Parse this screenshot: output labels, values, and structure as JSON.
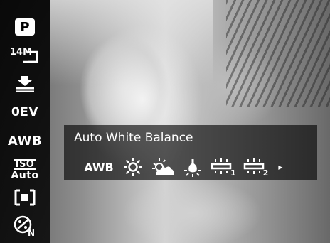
{
  "sidebar": {
    "items": [
      {
        "name": "program-mode-icon",
        "label": "P"
      },
      {
        "name": "image-size-icon",
        "label": "14M"
      },
      {
        "name": "quality-icon",
        "label": ""
      },
      {
        "name": "exposure-value",
        "label": "0EV"
      },
      {
        "name": "white-balance",
        "label": "AWB"
      },
      {
        "name": "iso-setting",
        "label_top": "ISO",
        "label_bottom": "Auto"
      },
      {
        "name": "metering-icon",
        "label": ""
      },
      {
        "name": "color-mode-icon",
        "label": "N"
      }
    ]
  },
  "panel": {
    "title": "Auto White Balance",
    "options": [
      {
        "name": "awb-option",
        "label": "AWB"
      },
      {
        "name": "daylight-icon",
        "label": ""
      },
      {
        "name": "cloudy-icon",
        "label": ""
      },
      {
        "name": "tungsten-icon",
        "label": ""
      },
      {
        "name": "fluorescent-1-icon",
        "label": "1"
      },
      {
        "name": "fluorescent-2-icon",
        "label": "2"
      }
    ],
    "more_indicator": "▸"
  }
}
